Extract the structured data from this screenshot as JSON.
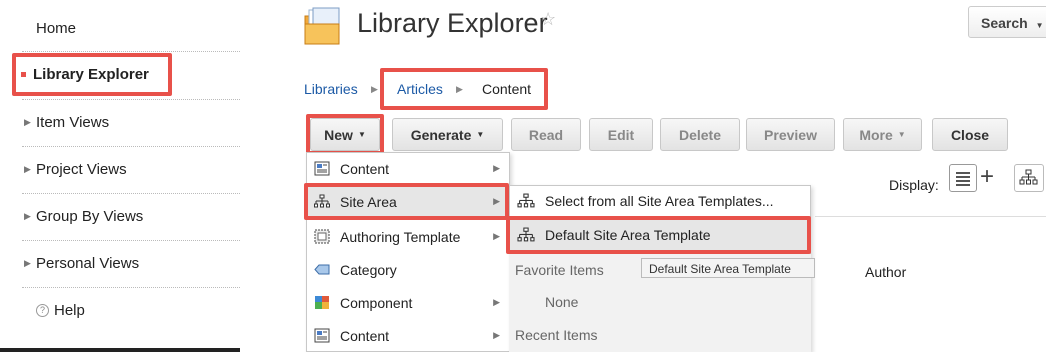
{
  "sidebar": {
    "items": [
      {
        "label": "Home"
      },
      {
        "label": "Library Explorer"
      },
      {
        "label": "Item Views"
      },
      {
        "label": "Project Views"
      },
      {
        "label": "Group By Views"
      },
      {
        "label": "Personal Views"
      },
      {
        "label": "Help"
      }
    ]
  },
  "header": {
    "title": "Library Explorer",
    "favorite_icon": "star-outline-icon",
    "search_label": "Search"
  },
  "breadcrumb": [
    "Libraries",
    "Articles",
    "Content"
  ],
  "toolbar": {
    "buttons": [
      {
        "label": "New",
        "dropdown": true
      },
      {
        "label": "Generate",
        "dropdown": true
      },
      {
        "label": "Read"
      },
      {
        "label": "Edit"
      },
      {
        "label": "Delete"
      },
      {
        "label": "Preview"
      },
      {
        "label": "More",
        "dropdown": true
      },
      {
        "label": "Close"
      }
    ],
    "display_label": "Display:"
  },
  "new_menu": {
    "items": [
      {
        "label": "Content",
        "icon": "content-icon",
        "submenu": true
      },
      {
        "label": "Site Area",
        "icon": "site-area-icon",
        "submenu": true
      },
      {
        "label": "Authoring Template",
        "icon": "authoring-template-icon",
        "submenu": true
      },
      {
        "label": "Category",
        "icon": "category-icon",
        "submenu": false
      },
      {
        "label": "Component",
        "icon": "component-icon",
        "submenu": true
      },
      {
        "label": "Content",
        "icon": "content-icon",
        "submenu": true
      }
    ]
  },
  "site_area_submenu": {
    "select_all": "Select from all Site Area Templates...",
    "default_template": "Default Site Area Template",
    "favorite_header": "Favorite Items",
    "favorite_none": "None",
    "recent_header": "Recent Items",
    "tooltip": "Default Site Area Template"
  },
  "table": {
    "author_column": "Author"
  },
  "colors": {
    "highlight": "#e8514a",
    "link": "#1c5aa6"
  }
}
